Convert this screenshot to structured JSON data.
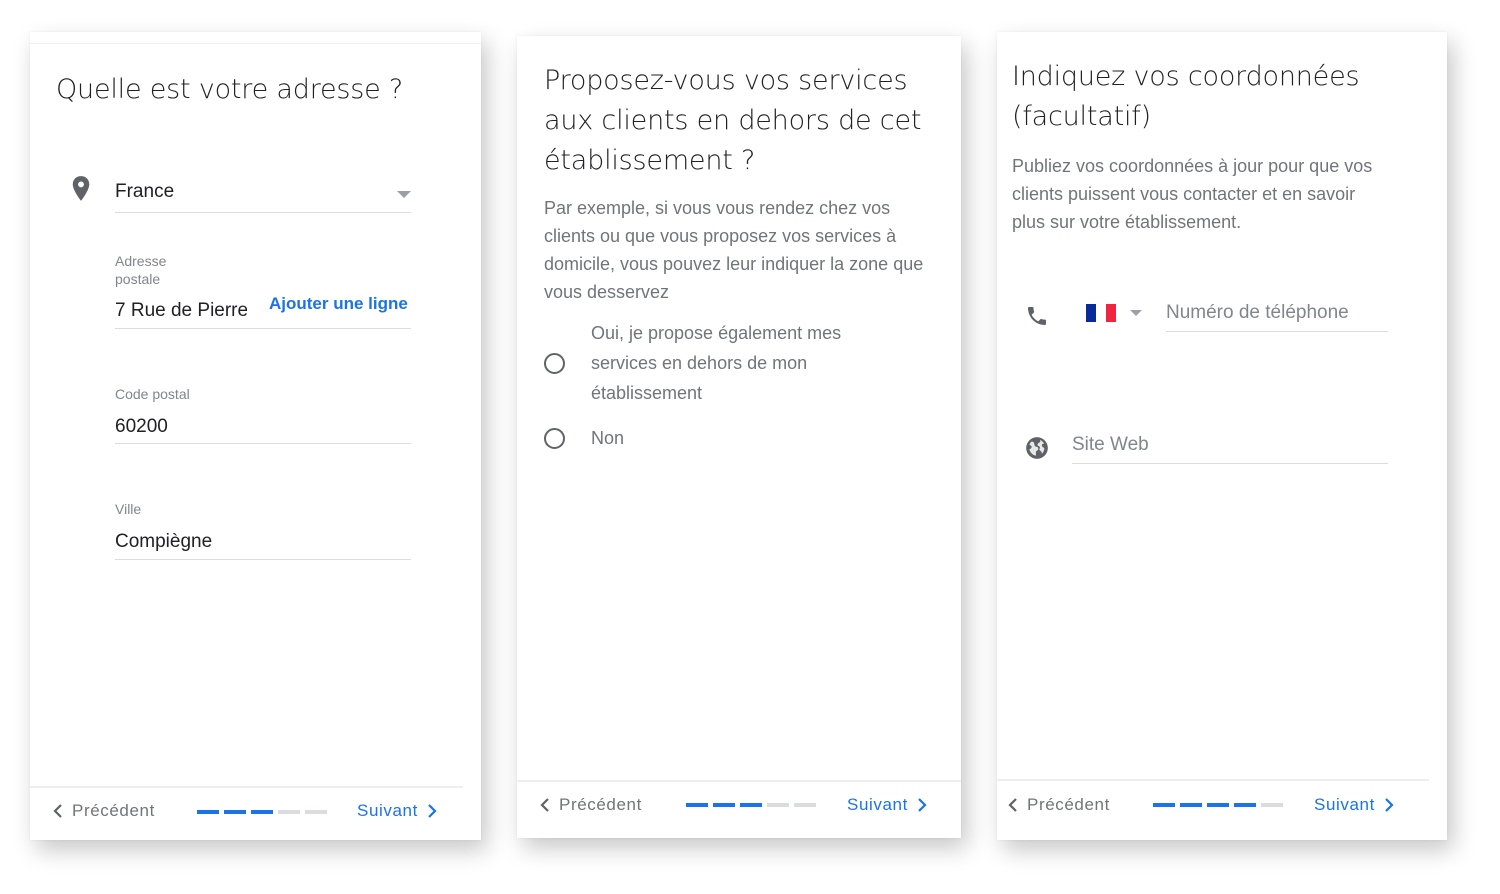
{
  "colors": {
    "accent": "#1a73e8",
    "text_primary": "#202124",
    "text_secondary": "#70757a",
    "divider": "#dadce0",
    "progress_inactive": "#dadce0",
    "flag_blue": "#0a2a9a",
    "flag_white": "#ffffff",
    "flag_red": "#f0253f"
  },
  "cards": [
    {
      "title": "Quelle est votre adresse ?",
      "country": {
        "icon": "location-pin-icon",
        "value": "France"
      },
      "address": {
        "label": "Adresse postale",
        "value": "7 Rue de Pierre",
        "add_line_label": "Ajouter une ligne"
      },
      "postal_code": {
        "label": "Code postal",
        "value": "60200"
      },
      "city": {
        "label": "Ville",
        "value": "Compiègne"
      },
      "footer": {
        "prev_label": "Précédent",
        "next_label": "Suivant",
        "progress_steps_total": 5,
        "progress_steps_done": 3
      }
    },
    {
      "title": "Proposez-vous vos services aux clients en dehors de cet établissement ?",
      "description": "Par exemple, si vous vous rendez chez vos clients ou que vous proposez vos services à domicile, vous pouvez leur indiquer la zone que vous desservez",
      "options": [
        {
          "label": "Oui, je propose également mes services en dehors de mon établissement",
          "selected": false
        },
        {
          "label": "Non",
          "selected": false
        }
      ],
      "footer": {
        "prev_label": "Précédent",
        "next_label": "Suivant",
        "progress_steps_total": 5,
        "progress_steps_done": 3
      }
    },
    {
      "title": "Indiquez vos coordonnées (facultatif)",
      "description": "Publiez vos coordonnées à jour pour que vos clients puissent vous contacter et en savoir plus sur votre établissement.",
      "phone": {
        "icon": "phone-icon",
        "country_flag": "france-flag-icon",
        "placeholder": "Numéro de téléphone"
      },
      "website": {
        "icon": "globe-icon",
        "placeholder": "Site Web"
      },
      "footer": {
        "prev_label": "Précédent",
        "next_label": "Suivant",
        "progress_steps_total": 5,
        "progress_steps_done": 4
      }
    }
  ]
}
